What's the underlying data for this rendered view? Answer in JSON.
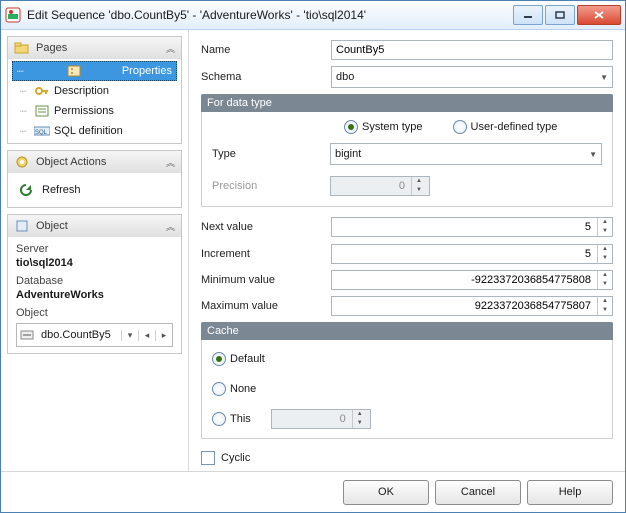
{
  "window": {
    "title": "Edit Sequence 'dbo.CountBy5' - 'AdventureWorks' - 'tio\\sql2014'"
  },
  "pages": {
    "header": "Pages",
    "items": [
      {
        "label": "Properties"
      },
      {
        "label": "Description"
      },
      {
        "label": "Permissions"
      },
      {
        "label": "SQL definition"
      }
    ]
  },
  "actions": {
    "header": "Object Actions",
    "refresh": "Refresh"
  },
  "object_panel": {
    "header": "Object",
    "server_lbl": "Server",
    "server": "tio\\sql2014",
    "database_lbl": "Database",
    "database": "AdventureWorks",
    "object_lbl": "Object",
    "object": "dbo.CountBy5"
  },
  "form": {
    "name_lbl": "Name",
    "name": "CountBy5",
    "schema_lbl": "Schema",
    "schema": "dbo",
    "datatype_hdr": "For data type",
    "system_type": "System type",
    "user_type": "User-defined type",
    "type_lbl": "Type",
    "type": "bigint",
    "precision_lbl": "Precision",
    "precision": "0",
    "next_lbl": "Next value",
    "next": "5",
    "incr_lbl": "Increment",
    "incr": "5",
    "min_lbl": "Minimum value",
    "min": "-9223372036854775808",
    "max_lbl": "Maximum value",
    "max": "9223372036854775807",
    "cache_hdr": "Cache",
    "cache_default": "Default",
    "cache_none": "None",
    "cache_this": "This",
    "cache_this_val": "0",
    "cyclic": "Cyclic"
  },
  "buttons": {
    "ok": "OK",
    "cancel": "Cancel",
    "help": "Help"
  }
}
